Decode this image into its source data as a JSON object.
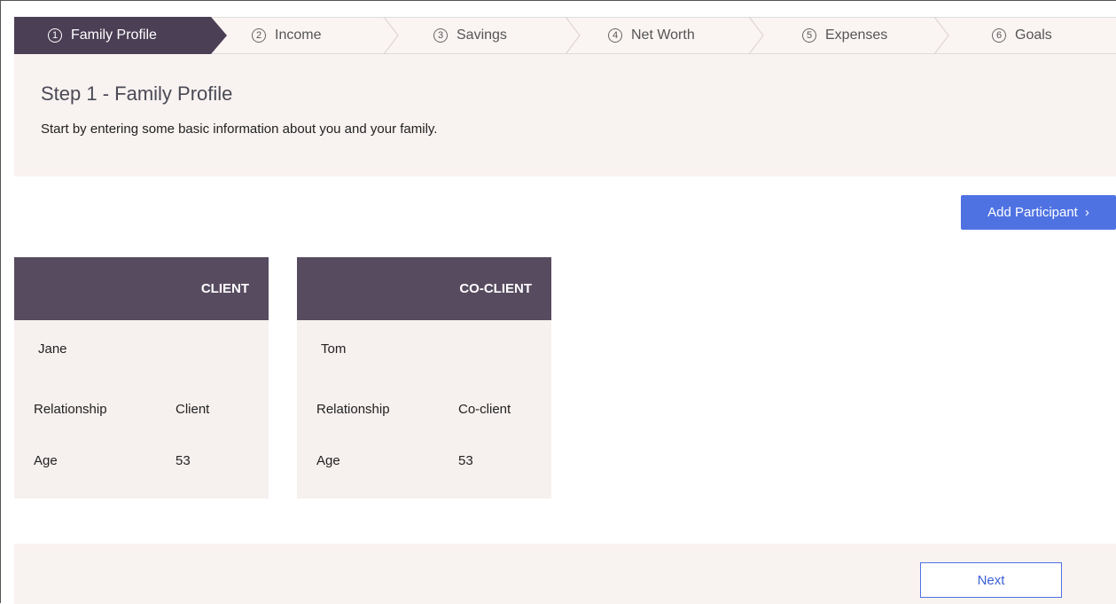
{
  "stepper": {
    "steps": [
      {
        "num": "1",
        "label": "Family Profile"
      },
      {
        "num": "2",
        "label": "Income"
      },
      {
        "num": "3",
        "label": "Savings"
      },
      {
        "num": "4",
        "label": "Net Worth"
      },
      {
        "num": "5",
        "label": "Expenses"
      },
      {
        "num": "6",
        "label": "Goals"
      }
    ],
    "active_color": "#4a3f54"
  },
  "header": {
    "title": "Step 1 - Family Profile",
    "subtitle": "Start by entering some basic information about you and your family."
  },
  "actions": {
    "add_participant": "Add Participant",
    "add_participant_arrow": "›",
    "next": "Next"
  },
  "participants": [
    {
      "role": "CLIENT",
      "name": "Jane",
      "relationship_label": "Relationship",
      "relationship": "Client",
      "age_label": "Age",
      "age": "53"
    },
    {
      "role": "CO-CLIENT",
      "name": "Tom",
      "relationship_label": "Relationship",
      "relationship": "Co-client",
      "age_label": "Age",
      "age": "53"
    }
  ],
  "colors": {
    "accent": "#4f72e3",
    "card_header": "#574b60",
    "panel_bg": "#f8f2f1"
  }
}
